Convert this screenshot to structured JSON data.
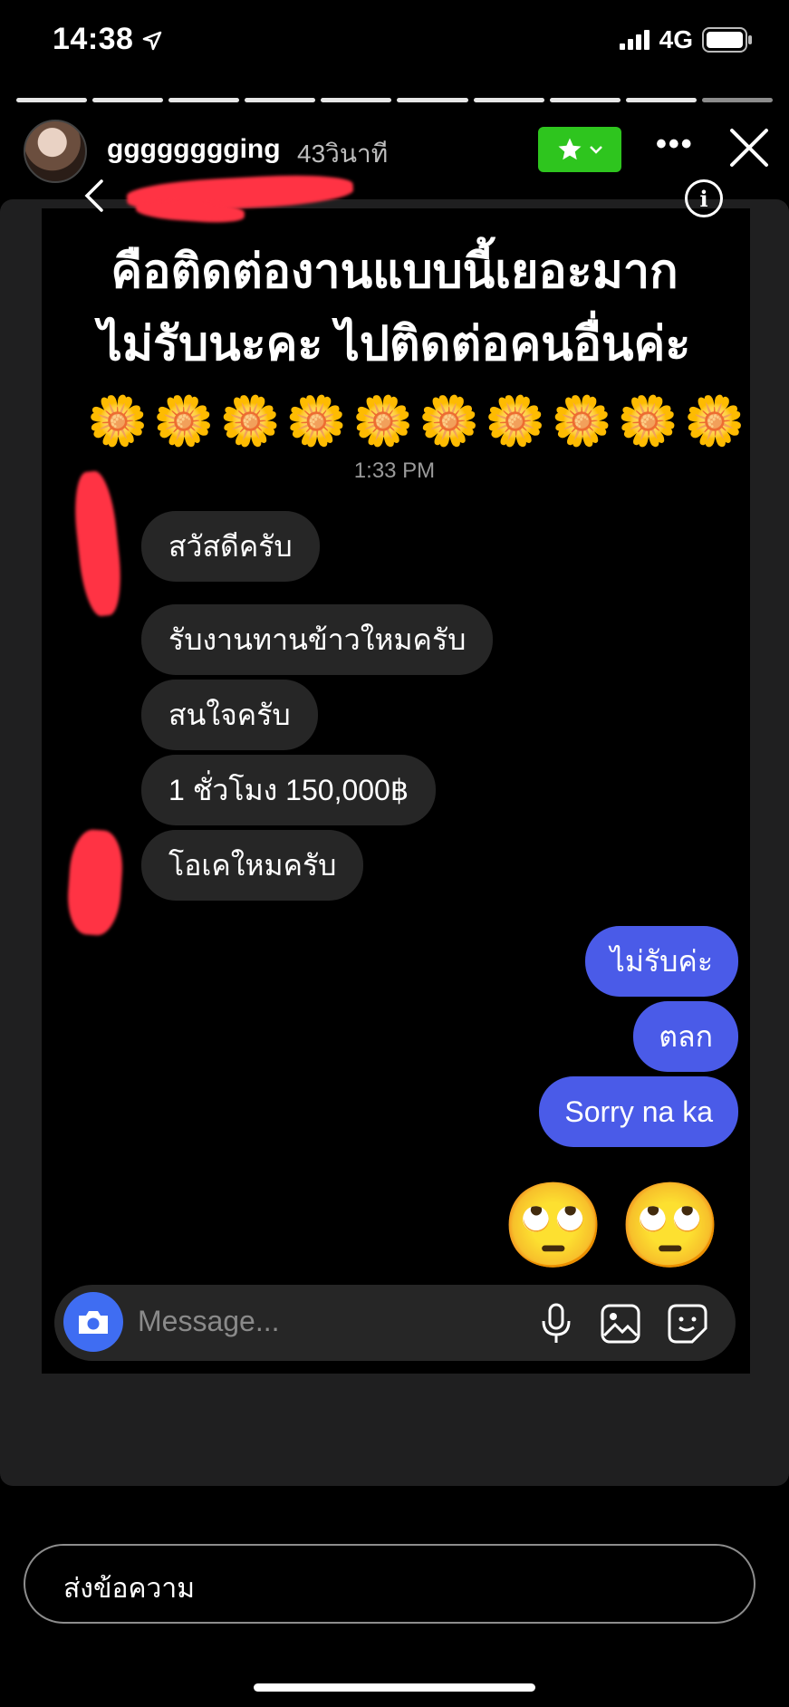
{
  "status_bar": {
    "time": "14:38",
    "network": "4G"
  },
  "story_header": {
    "username": "gggggggging",
    "time_ago": "43วินาที",
    "close_friends_icon": "star-icon"
  },
  "screenshot": {
    "caption_line1": "คือติดต่องานแบบนี้เยอะมาก",
    "caption_line2": "ไม่รับนะคะ ไปติดต่อคนอื่นค่ะ",
    "flowers": "🌼🌼🌼🌼🌼🌼🌼🌼🌼🌼",
    "chat_time": "1:33 PM",
    "incoming": [
      "สวัสดีครับ",
      "รับงานทานข้าวใหมครับ",
      "สนใจครับ",
      "1 ชั่วโมง 150,000฿",
      "โอเคใหมครับ"
    ],
    "outgoing": [
      "ไม่รับค่ะ",
      "ตลก",
      "Sorry na ka"
    ],
    "emojis": "🙄🙄",
    "message_placeholder": "Message..."
  },
  "reply": {
    "placeholder": "ส่งข้อความ"
  },
  "colors": {
    "outgoing_bubble": "#4a5be8",
    "incoming_bubble": "#262626",
    "close_friends": "#2ec51e"
  }
}
